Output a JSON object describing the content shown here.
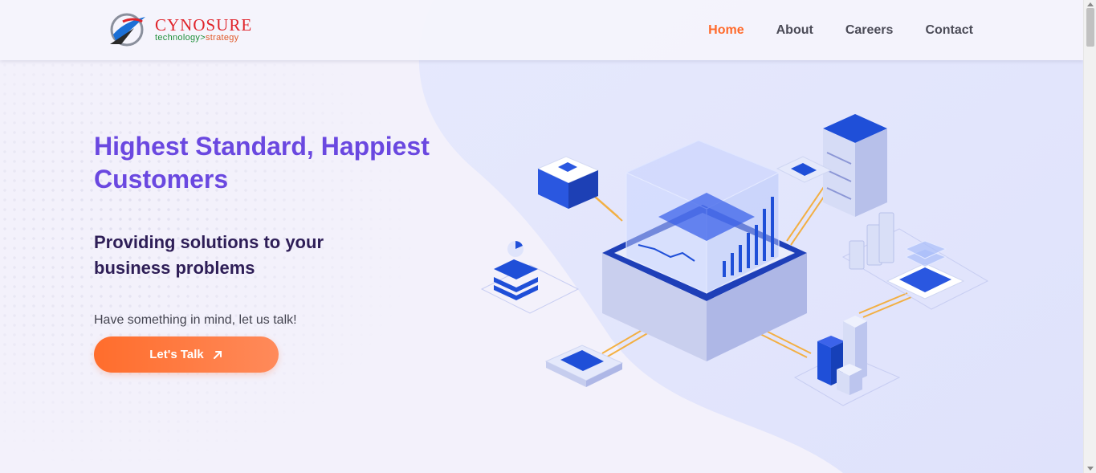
{
  "brand": {
    "name": "CYNOSURE",
    "tagline_part1": "technology",
    "tagline_sep": ">",
    "tagline_part2": "strategy"
  },
  "nav": {
    "items": [
      {
        "label": "Home",
        "active": true
      },
      {
        "label": "About",
        "active": false
      },
      {
        "label": "Careers",
        "active": false
      },
      {
        "label": "Contact",
        "active": false
      }
    ]
  },
  "hero": {
    "title": "Highest Standard, Happiest Customers",
    "subtitle": "Providing solutions to your business problems",
    "cta_prompt": "Have something in mind, let us talk!",
    "cta_label": "Let's Talk"
  },
  "colors": {
    "accent": "#ff6a2b",
    "title": "#6a48e0",
    "subtitle": "#2e1e57",
    "illustration_blue": "#1f4fd8"
  },
  "icons": [
    "arrow-up-right-icon",
    "logo-icon"
  ]
}
